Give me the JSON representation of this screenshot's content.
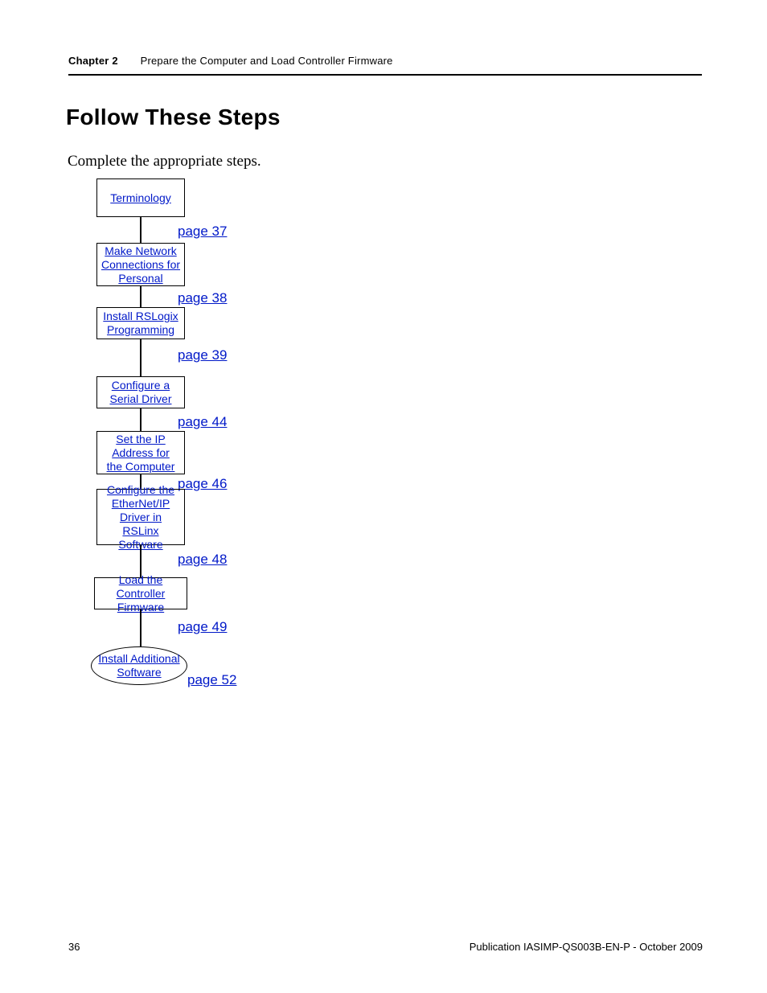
{
  "header": {
    "chapter": "Chapter  2",
    "title": "Prepare the Computer and Load Controller Firmware"
  },
  "heading": "Follow These Steps",
  "intro": "Complete the appropriate steps.",
  "flow": {
    "nodes": [
      {
        "lines": [
          "Terminology"
        ]
      },
      {
        "lines": [
          "Make Network",
          "Connections for",
          "Personal"
        ]
      },
      {
        "lines": [
          "Install   RSLogix",
          "Programming"
        ]
      },
      {
        "lines": [
          "Configure   a",
          "Serial Driver"
        ]
      },
      {
        "lines": [
          "Set the IP",
          "Address for",
          "the Computer"
        ]
      },
      {
        "lines": [
          "Configure the",
          "EtherNet/IP",
          "Driver in RSLinx",
          "Software"
        ]
      },
      {
        "lines": [
          "Load the Controller",
          "Firmware"
        ]
      },
      {
        "lines": [
          "Install Additional",
          "Software"
        ]
      }
    ],
    "pagerefs": [
      "page 37",
      "page 38",
      "page 39",
      "page 44",
      "page 46",
      "page 48",
      "page 49",
      "page 52"
    ]
  },
  "footer": {
    "pagenum": "36",
    "pubref": "Publication IASIMP-QS003B-EN-P - October 2009"
  }
}
